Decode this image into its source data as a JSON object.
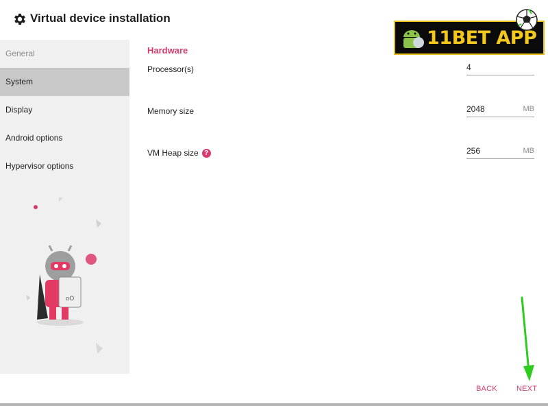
{
  "header": {
    "title": "Virtual device installation",
    "icon": "gear-icon"
  },
  "sidebar": {
    "items": [
      {
        "label": "General",
        "state": "muted"
      },
      {
        "label": "System",
        "state": "active"
      },
      {
        "label": "Display",
        "state": "normal"
      },
      {
        "label": "Android options",
        "state": "normal"
      },
      {
        "label": "Hypervisor options",
        "state": "normal"
      }
    ]
  },
  "main": {
    "section_title": "Hardware",
    "rows": [
      {
        "label": "Processor(s)",
        "value": "4",
        "unit": ""
      },
      {
        "label": "Memory size",
        "value": "2048",
        "unit": "MB"
      },
      {
        "label": "VM Heap size",
        "value": "256",
        "unit": "MB",
        "help_icon": "?"
      }
    ]
  },
  "footer": {
    "back_label": "BACK",
    "next_label": "NEXT"
  },
  "banner": {
    "text": "11BET APP"
  },
  "colors": {
    "accent": "#d63a6e",
    "sidebar_bg": "#f0f0f0",
    "sidebar_active": "#c8c8c8",
    "banner_gold": "#f2c81d",
    "arrow_green": "#2ecc1f"
  }
}
